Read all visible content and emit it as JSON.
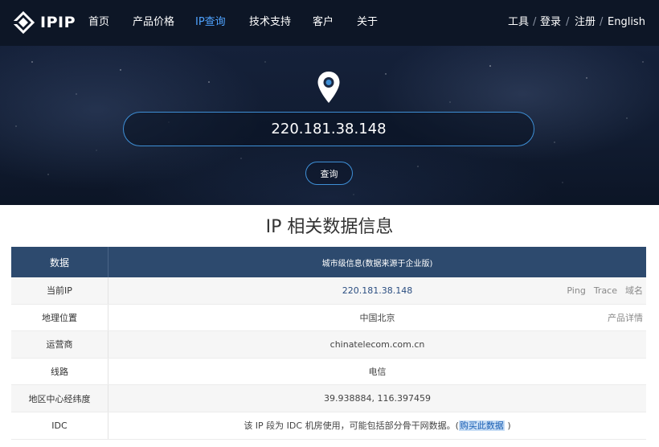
{
  "header": {
    "logo_text": "IPIP",
    "nav": [
      {
        "label": "首页",
        "active": false
      },
      {
        "label": "产品价格",
        "active": false
      },
      {
        "label": "IP查询",
        "active": true
      },
      {
        "label": "技术支持",
        "active": false
      },
      {
        "label": "客户",
        "active": false
      },
      {
        "label": "关于",
        "active": false
      }
    ],
    "tools_label": "工具",
    "login_label": "登录",
    "register_label": "注册",
    "english_label": "English",
    "separator": "/",
    "active_color": "#4fa3ff"
  },
  "hero": {
    "pin_icon": "location-pin-icon",
    "ip_value": "220.181.38.148",
    "query_label": "查询",
    "accent_color": "#3e8fd6"
  },
  "section": {
    "title": "IP 相关数据信息"
  },
  "table": {
    "header": {
      "col1": "数据",
      "col2": "城市级信息(数据来源于企业版)"
    },
    "rows": [
      {
        "label": "当前IP",
        "value": "220.181.38.148"
      },
      {
        "label": "地理位置",
        "value": "中国北京"
      },
      {
        "label": "运营商",
        "value": "chinatelecom.com.cn"
      },
      {
        "label": "线路",
        "value": "电信"
      },
      {
        "label": "地区中心经纬度",
        "value": "39.938884, 116.397459"
      },
      {
        "label": "IDC",
        "value_prefix": "该 IP 段为 IDC 机房使用，可能包括部分骨干网数据。(",
        "value_link": "购买此数据",
        "value_suffix": " )"
      }
    ],
    "ip_actions": {
      "ping": "Ping",
      "trace": "Trace",
      "domain": "域名"
    },
    "geo_actions": {
      "detail": "产品详情"
    },
    "header_color": "#2d4a6e"
  }
}
